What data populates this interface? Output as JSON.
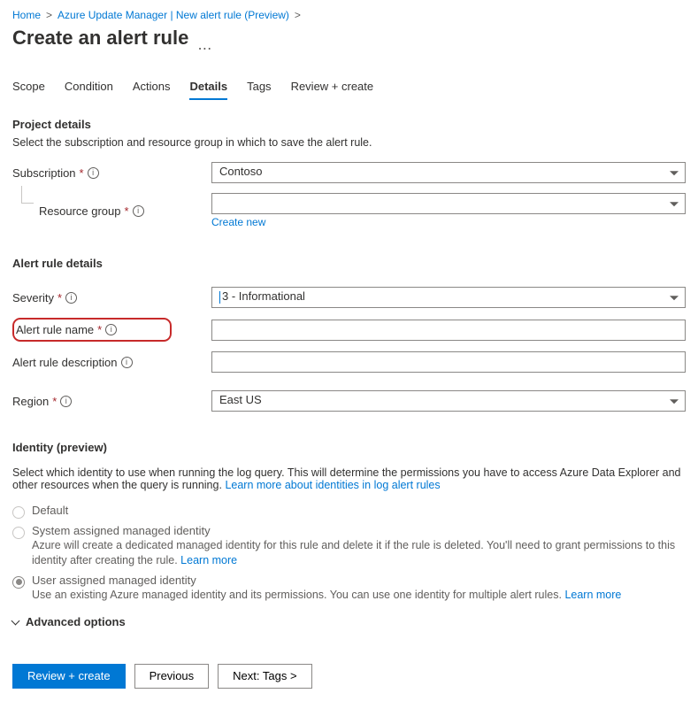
{
  "breadcrumb": {
    "home": "Home",
    "mid": "Azure Update Manager | New alert rule (Preview)"
  },
  "page_title": "Create an alert rule",
  "tabs": {
    "scope": "Scope",
    "condition": "Condition",
    "actions": "Actions",
    "details": "Details",
    "tags": "Tags",
    "review": "Review + create"
  },
  "project": {
    "title": "Project details",
    "desc": "Select the subscription and resource group in which to save the alert rule.",
    "subscription_label": "Subscription",
    "subscription_value": "Contoso",
    "resource_group_label": "Resource group",
    "resource_group_value": "",
    "create_new": "Create new"
  },
  "alert": {
    "title": "Alert rule details",
    "severity_label": "Severity",
    "severity_value": "3 - Informational",
    "name_label": "Alert rule name",
    "name_value": "",
    "desc_label": "Alert rule description",
    "desc_value": "",
    "region_label": "Region",
    "region_value": "East US"
  },
  "identity": {
    "title": "Identity (preview)",
    "desc_pre": "Select which identity to use when running the log query. This will determine the permissions you have to access Azure Data Explorer and other resources when the query is running.",
    "desc_link": "Learn more about identities in log alert rules",
    "opt_default": "Default",
    "opt_sys": "System assigned managed identity",
    "opt_sys_desc_pre": "Azure will create a dedicated managed identity for this rule and delete it if the rule is deleted. You'll need to grant permissions to this identity after creating the rule.",
    "opt_sys_link": "Learn more",
    "opt_user": "User assigned managed identity",
    "opt_user_desc_pre": "Use an existing Azure managed identity and its permissions. You can use one identity for multiple alert rules.",
    "opt_user_link": "Learn more"
  },
  "advanced": "Advanced options",
  "footer": {
    "review": "Review + create",
    "previous": "Previous",
    "next": "Next: Tags >"
  }
}
